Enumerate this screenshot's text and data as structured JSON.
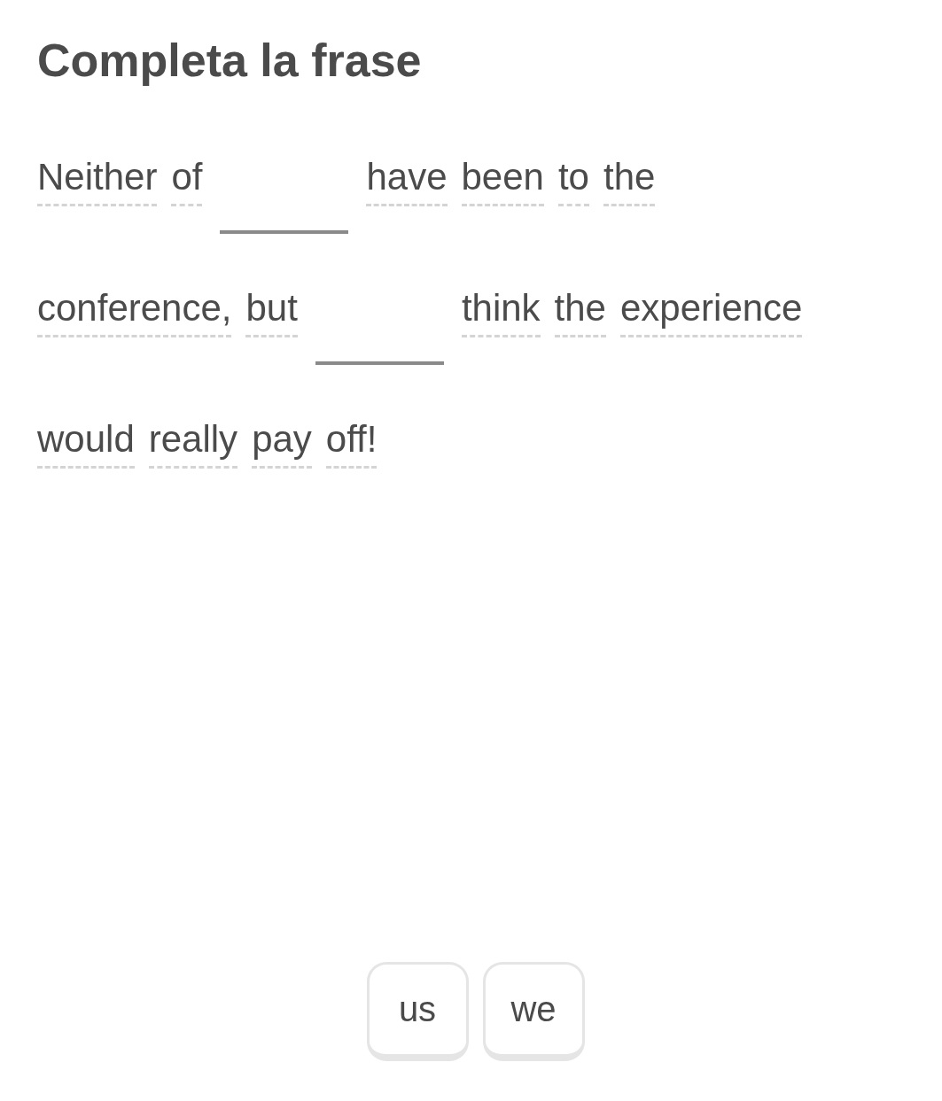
{
  "title": "Completa la frase",
  "sentence_lines": [
    [
      {
        "kind": "word",
        "text": "Neither"
      },
      {
        "kind": "word",
        "text": "of"
      },
      {
        "kind": "blank"
      },
      {
        "kind": "word",
        "text": "have"
      },
      {
        "kind": "word",
        "text": "been"
      },
      {
        "kind": "word",
        "text": "to"
      },
      {
        "kind": "word",
        "text": "the"
      }
    ],
    [
      {
        "kind": "word",
        "text": "conference,"
      },
      {
        "kind": "word",
        "text": "but"
      },
      {
        "kind": "blank"
      },
      {
        "kind": "word",
        "text": "think"
      },
      {
        "kind": "word",
        "text": "the"
      },
      {
        "kind": "word",
        "text": "experience"
      }
    ],
    [
      {
        "kind": "word",
        "text": "would"
      },
      {
        "kind": "word",
        "text": "really"
      },
      {
        "kind": "word",
        "text": "pay"
      },
      {
        "kind": "word",
        "text": "off!"
      }
    ]
  ],
  "word_bank": [
    "us",
    "we"
  ]
}
